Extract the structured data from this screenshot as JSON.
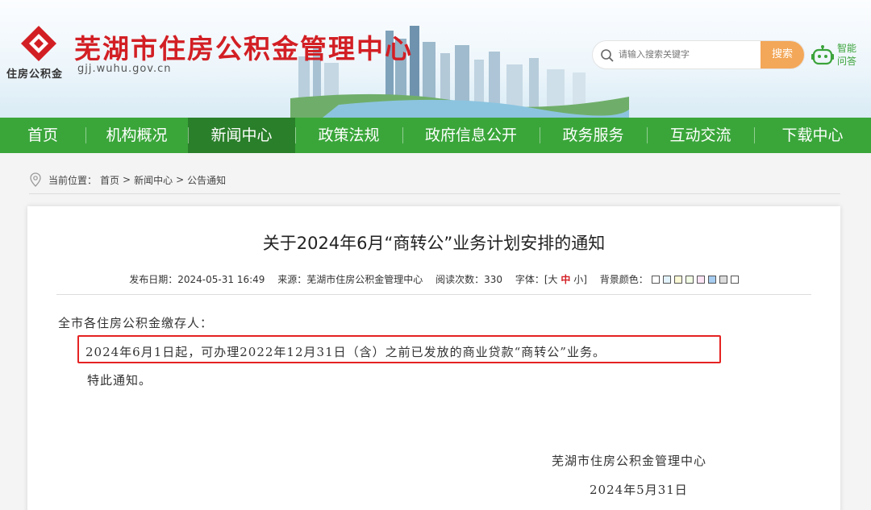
{
  "header": {
    "title": "芜湖市住房公积金管理中心",
    "domain": "gjj.wuhu.gov.cn",
    "logo_text": "住房公积金",
    "search_placeholder": "请输入搜索关键字",
    "search_button": "搜索",
    "assistant_label": "智能问答",
    "brand_red": "#d21f24"
  },
  "nav": {
    "items": [
      "首页",
      "机构概况",
      "新闻中心",
      "政策法规",
      "政府信息公开",
      "政务服务",
      "互动交流",
      "下载中心"
    ],
    "active": "新闻中心",
    "color": "#3aa63a"
  },
  "breadcrumb": {
    "label": "当前位置：",
    "items": [
      "首页",
      ">",
      "新闻中心",
      ">",
      "公告通知"
    ]
  },
  "article": {
    "title": "关于2024年6月“商转公”业务计划安排的通知",
    "meta": {
      "date": "发布日期：2024-05-31 16:49",
      "source": "来源：芜湖市住房公积金管理中心",
      "reads": "阅读次数：330",
      "font_label": "字体：",
      "font_large": "[大",
      "font_medium": "中",
      "font_small": "小]",
      "bg_label": "背景颜色：",
      "bg_colors": [
        "#ffffff",
        "#e3f3fd",
        "#fbf9d6",
        "#f2ffe5",
        "#fde4f5",
        "#a7cdf0",
        "#dcdcdc",
        "#ffffff"
      ]
    },
    "greeting": "全市各住房公积金缴存人：",
    "body_line1": "2024年6月1日起，可办理2022年12月31日（含）之前已发放的商业贷款“商转公”业务。",
    "body_line2": "特此通知。",
    "signature": "芜湖市住房公积金管理中心",
    "sign_date": "2024年5月31日"
  }
}
